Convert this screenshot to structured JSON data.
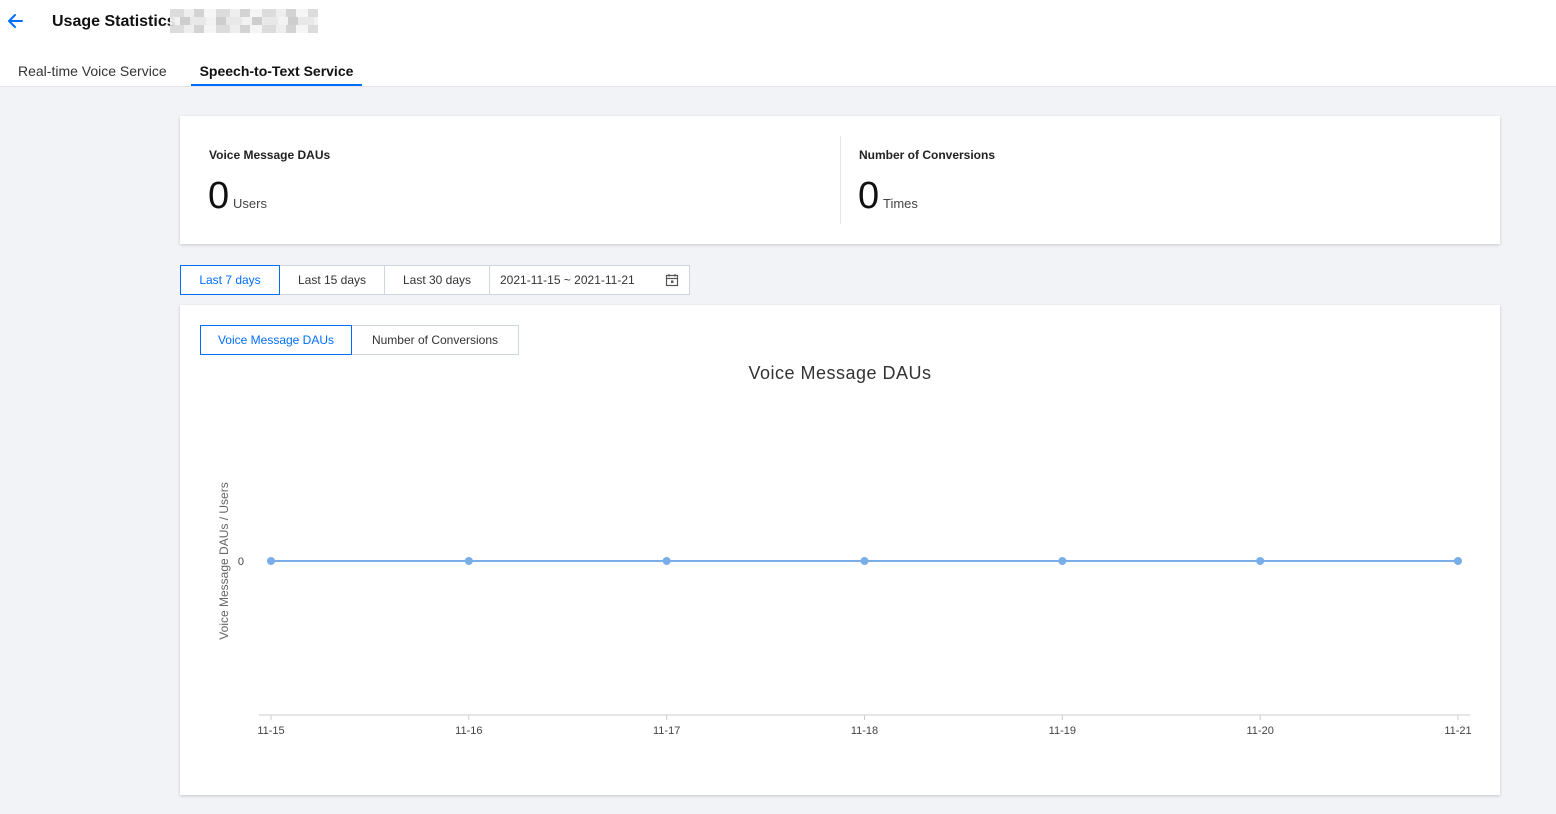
{
  "header": {
    "title": "Usage Statistics",
    "back_icon": "arrow-left-icon",
    "accent_color": "#006eff"
  },
  "tabs": [
    {
      "label": "Real-time Voice Service",
      "active": false
    },
    {
      "label": "Speech-to-Text Service",
      "active": true
    }
  ],
  "summary": {
    "dau": {
      "label": "Voice Message DAUs",
      "value": "0",
      "unit": "Users"
    },
    "conversions": {
      "label": "Number of Conversions",
      "value": "0",
      "unit": "Times"
    }
  },
  "range": {
    "options": [
      "Last 7 days",
      "Last 15 days",
      "Last 30 days"
    ],
    "selected": "Last 7 days",
    "date_range": "2021-11-15 ~ 2021-11-21",
    "calendar_icon": "calendar-icon"
  },
  "metric_tabs": {
    "options": [
      "Voice Message DAUs",
      "Number of Conversions"
    ],
    "selected": "Voice Message DAUs"
  },
  "chart_data": {
    "type": "line",
    "title": "Voice Message DAUs",
    "xlabel": "",
    "ylabel": "Voice Message DAUs / Users",
    "categories": [
      "11-15",
      "11-16",
      "11-17",
      "11-18",
      "11-19",
      "11-20",
      "11-21"
    ],
    "series": [
      {
        "values": [
          0,
          0,
          0,
          0,
          0,
          0,
          0
        ],
        "color": "#7aaee8"
      }
    ],
    "yticks": [
      "0"
    ],
    "grid": false,
    "legend": "none"
  }
}
